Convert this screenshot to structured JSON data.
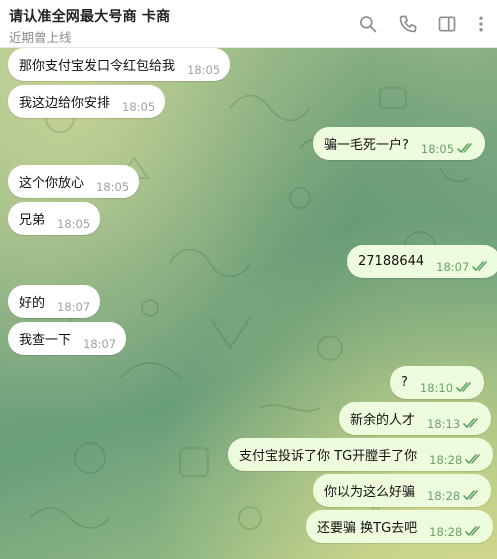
{
  "header": {
    "title": "请认准全网最大号商 卡商",
    "status": "近期曾上线",
    "icons": [
      "search-icon",
      "phone-icon",
      "sidebar-toggle-icon",
      "more-icon"
    ]
  },
  "colors": {
    "incoming_bubble": "#ffffff",
    "outgoing_bubble": "#eefcde",
    "read_ticks": "#5fa35f"
  },
  "messages": [
    {
      "text": "那你支付宝发口令红包给我",
      "time": "18:05",
      "direction": "in"
    },
    {
      "text": "我这边给你安排",
      "time": "18:05",
      "direction": "in"
    },
    {
      "text": "骗一毛死一户?",
      "time": "18:05",
      "direction": "out",
      "read": true
    },
    {
      "text": "这个你放心",
      "time": "18:05",
      "direction": "in"
    },
    {
      "text": "兄弟",
      "time": "18:05",
      "direction": "in"
    },
    {
      "text": "27188644",
      "time": "18:07",
      "direction": "out",
      "read": true
    },
    {
      "text": "好的",
      "time": "18:07",
      "direction": "in"
    },
    {
      "text": "我查一下",
      "time": "18:07",
      "direction": "in"
    },
    {
      "text": "?",
      "time": "18:10",
      "direction": "out",
      "read": true
    },
    {
      "text": "新余的人才",
      "time": "18:13",
      "direction": "out",
      "read": true
    },
    {
      "text": "支付宝投诉了你 TG开膛手了你",
      "time": "18:28",
      "direction": "out",
      "read": true
    },
    {
      "text": "你以为这么好骗",
      "time": "18:28",
      "direction": "out",
      "read": true
    },
    {
      "text": "还要骗 换TG去吧",
      "time": "18:28",
      "direction": "out",
      "read": true
    }
  ]
}
